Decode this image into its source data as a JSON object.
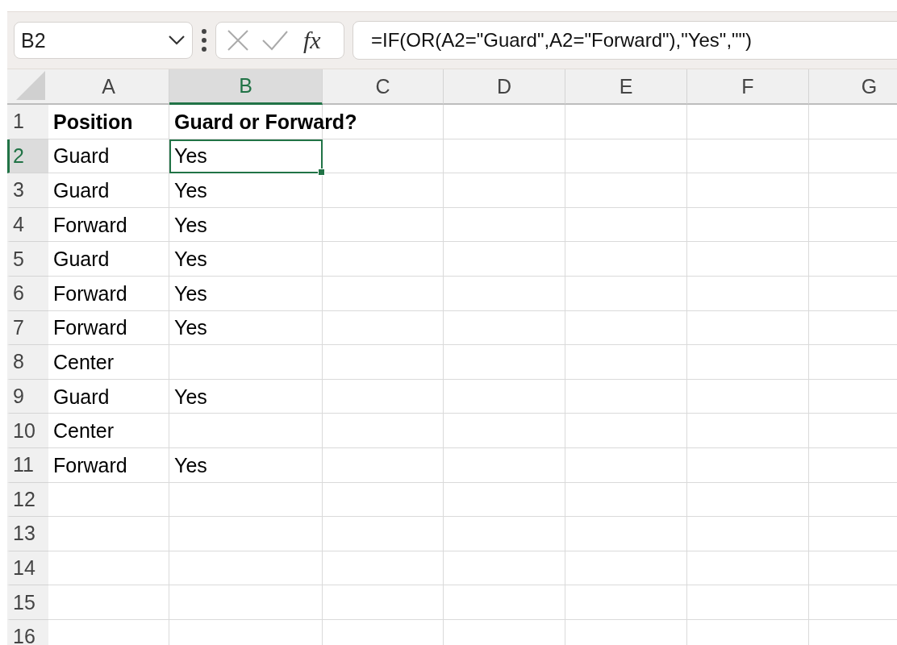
{
  "name_box": {
    "value": "B2"
  },
  "formula_bar": {
    "function_label": "fx",
    "formula": "=IF(OR(A2=\"Guard\",A2=\"Forward\"),\"Yes\",\"\")"
  },
  "columns": [
    {
      "label": "A",
      "selected": false
    },
    {
      "label": "B",
      "selected": true
    },
    {
      "label": "C",
      "selected": false
    },
    {
      "label": "D",
      "selected": false
    },
    {
      "label": "E",
      "selected": false
    },
    {
      "label": "F",
      "selected": false
    },
    {
      "label": "G",
      "selected": false
    }
  ],
  "rows": [
    {
      "number": "1",
      "selected": false,
      "kind": "header",
      "cells": [
        "Position",
        "Guard or Forward?"
      ]
    },
    {
      "number": "2",
      "selected": true,
      "kind": "data",
      "cells": [
        "Guard",
        "Yes"
      ]
    },
    {
      "number": "3",
      "selected": false,
      "kind": "data",
      "cells": [
        "Guard",
        "Yes"
      ]
    },
    {
      "number": "4",
      "selected": false,
      "kind": "data",
      "cells": [
        "Forward",
        "Yes"
      ]
    },
    {
      "number": "5",
      "selected": false,
      "kind": "data",
      "cells": [
        "Guard",
        "Yes"
      ]
    },
    {
      "number": "6",
      "selected": false,
      "kind": "data",
      "cells": [
        "Forward",
        "Yes"
      ]
    },
    {
      "number": "7",
      "selected": false,
      "kind": "data",
      "cells": [
        "Forward",
        "Yes"
      ]
    },
    {
      "number": "8",
      "selected": false,
      "kind": "data",
      "cells": [
        "Center"
      ]
    },
    {
      "number": "9",
      "selected": false,
      "kind": "data",
      "cells": [
        "Guard",
        "Yes"
      ]
    },
    {
      "number": "10",
      "selected": false,
      "kind": "data",
      "cells": [
        "Center"
      ]
    },
    {
      "number": "11",
      "selected": false,
      "kind": "data",
      "cells": [
        "Forward",
        "Yes"
      ]
    },
    {
      "number": "12",
      "selected": false,
      "kind": "data"
    },
    {
      "number": "13",
      "selected": false,
      "kind": "data"
    },
    {
      "number": "14",
      "selected": false,
      "kind": "data"
    },
    {
      "number": "15",
      "selected": false,
      "kind": "data"
    },
    {
      "number": "16",
      "selected": false,
      "kind": "data"
    }
  ]
}
